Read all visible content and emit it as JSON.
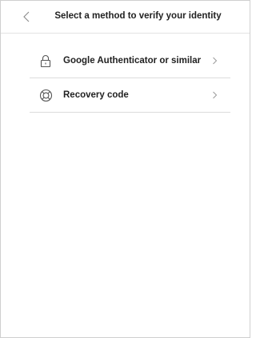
{
  "header": {
    "title": "Select a method to verify your identity",
    "back_icon": "chevron-left-icon"
  },
  "methods": [
    {
      "label": "Google Authenticator or similar",
      "icon": "lock-icon",
      "trailing_icon": "chevron-right-icon"
    },
    {
      "label": "Recovery code",
      "icon": "lifebuoy-icon",
      "trailing_icon": "chevron-right-icon"
    }
  ],
  "colors": {
    "text": "#222222",
    "icon": "#555555",
    "chevron": "#9a9a9a",
    "divider": "#dcdcdc"
  }
}
